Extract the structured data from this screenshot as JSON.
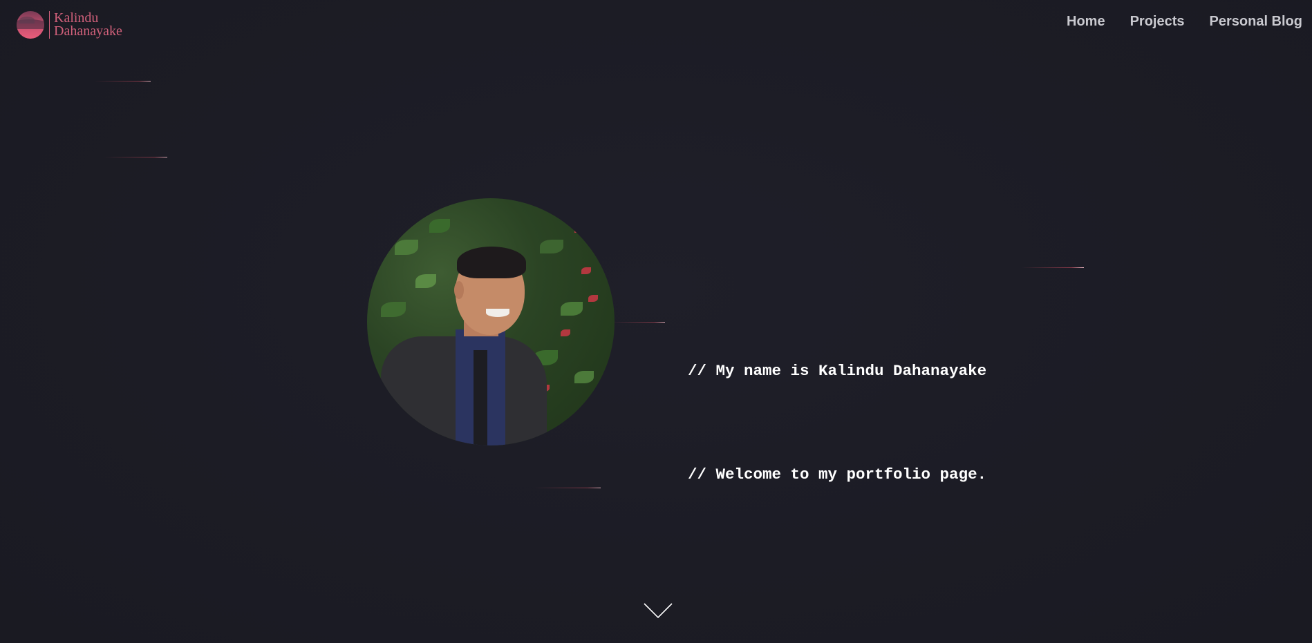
{
  "header": {
    "logo": {
      "icon": "logo-mark-icon",
      "line1": "Kalindu",
      "line2": "Dahanayake"
    },
    "nav": [
      {
        "label": "Home"
      },
      {
        "label": "Projects"
      },
      {
        "label": "Personal Blog"
      }
    ]
  },
  "hero": {
    "avatar_alt": "Profile photo",
    "lines": [
      "// My name is Kalindu Dahanayake",
      "// Welcome to my portfolio page."
    ]
  },
  "scroll": {
    "icon": "chevron-down-icon"
  },
  "colors": {
    "background": "#1c1c25",
    "accent": "#d0607a",
    "nav_text": "#c9c9cf",
    "intro_text": "#ffffff"
  }
}
